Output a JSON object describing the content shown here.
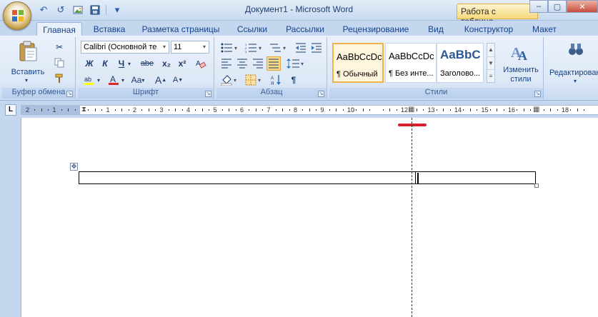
{
  "window": {
    "title": "Документ1 - Microsoft Word",
    "context_tab": "Работа с таблица...",
    "controls": {
      "minimize": "–",
      "maximize": "▢",
      "close": "✕"
    }
  },
  "qat": {
    "undo": "↶",
    "redo": "↺",
    "more": "▾"
  },
  "tabs": [
    {
      "label": "Главная"
    },
    {
      "label": "Вставка"
    },
    {
      "label": "Разметка страницы"
    },
    {
      "label": "Ссылки"
    },
    {
      "label": "Рассылки"
    },
    {
      "label": "Рецензирование"
    },
    {
      "label": "Вид"
    },
    {
      "label": "Конструктор"
    },
    {
      "label": "Макет"
    }
  ],
  "ribbon": {
    "clipboard": {
      "paste_label": "Вставить",
      "group_label": "Буфер обмена"
    },
    "font": {
      "font_name": "Calibri (Основной те",
      "font_size": "11",
      "bold": "Ж",
      "italic": "К",
      "underline": "Ч",
      "strike": "abe",
      "subscript": "x₂",
      "superscript": "x²",
      "grow": "A",
      "shrink": "A",
      "case": "Aa",
      "group_label": "Шрифт"
    },
    "paragraph": {
      "pilcrow": "¶",
      "group_label": "Абзац"
    },
    "styles": {
      "items": [
        {
          "sample": "AaBbCcDc",
          "name": "¶ Обычный"
        },
        {
          "sample": "AaBbCcDc",
          "name": "¶ Без инте..."
        },
        {
          "sample": "AaBbC",
          "name": "Заголово..."
        }
      ],
      "change_label": "Изменить стили",
      "group_label": "Стили"
    },
    "editing": {
      "label": "Редактирование"
    }
  },
  "ruler": {
    "tab_selector": "L",
    "numbers": [
      "2",
      "1",
      "1",
      "2",
      "3",
      "4",
      "5",
      "6",
      "7",
      "8",
      "9",
      "10",
      "11",
      "12",
      "13",
      "14",
      "15",
      "16",
      "17",
      "18"
    ]
  },
  "colors": {
    "accent": "#15428b",
    "ribbon_bg": "#dde8f6",
    "context_tab": "#f6d97a",
    "highlight_line": "#d8202c"
  }
}
